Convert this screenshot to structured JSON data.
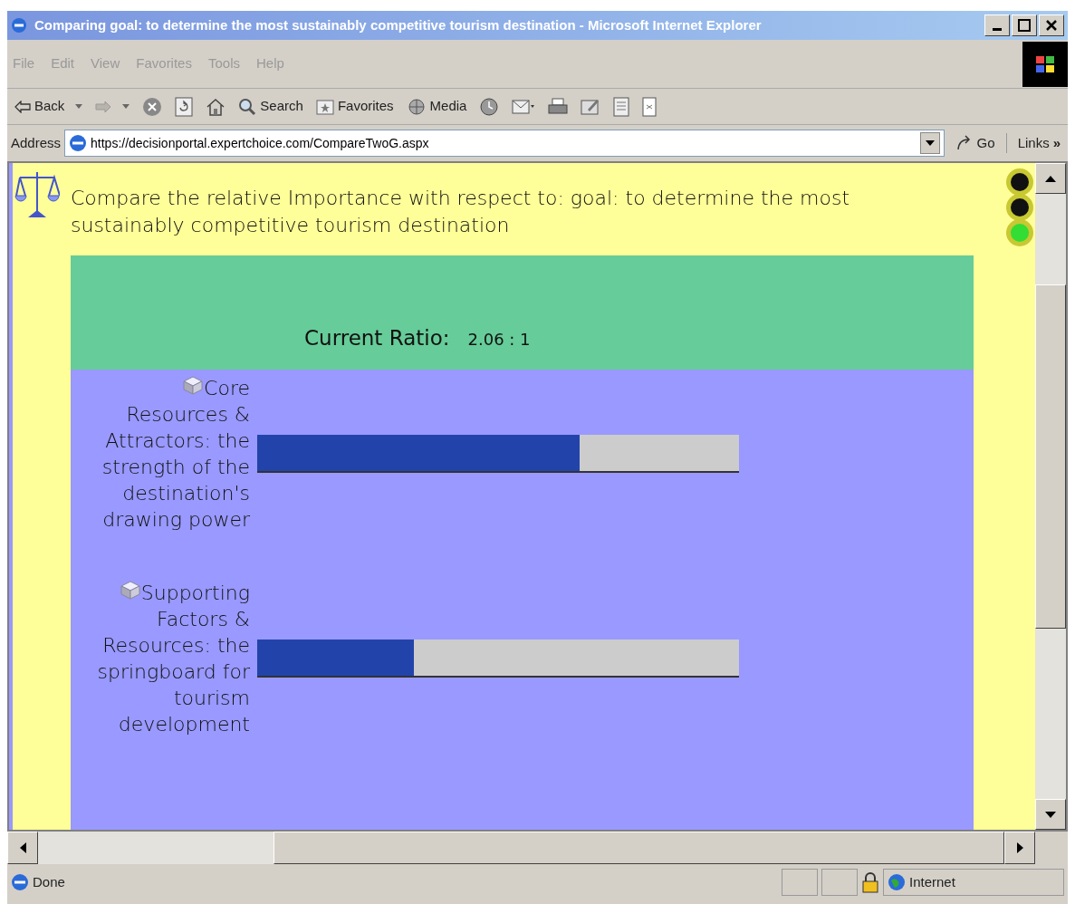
{
  "window": {
    "title": "Comparing goal: to determine the most sustainably competitive tourism destination - Microsoft Internet Explorer"
  },
  "menu": [
    "File",
    "Edit",
    "View",
    "Favorites",
    "Tools",
    "Help"
  ],
  "toolbar": [
    {
      "kind": "back",
      "label": "Back"
    },
    {
      "kind": "forward"
    },
    {
      "kind": "stop"
    },
    {
      "kind": "refresh"
    },
    {
      "kind": "home"
    },
    {
      "kind": "search",
      "label": "Search"
    },
    {
      "kind": "favorites",
      "label": "Favorites"
    },
    {
      "kind": "media",
      "label": "Media"
    },
    {
      "kind": "history"
    },
    {
      "kind": "mail"
    },
    {
      "kind": "print"
    },
    {
      "kind": "edit"
    },
    {
      "kind": "discuss"
    },
    {
      "kind": "messenger"
    }
  ],
  "address": {
    "label": "Address",
    "url": "https://decisionportal.expertchoice.com/CompareTwoG.aspx",
    "go": "Go",
    "links": "Links",
    "more": "»"
  },
  "page": {
    "heading": "Compare the relative Importance with respect to: goal: to determine the most sustainably competitive tourism destination",
    "lights": [
      {
        "on": false
      },
      {
        "on": false
      },
      {
        "on": true
      }
    ],
    "ratio_label": "Current Ratio:",
    "ratio": "2.06 : 1",
    "items": [
      {
        "name": "Core Resources & Attractors: the strength of the destination's drawing power",
        "level": 0.67
      },
      {
        "name": "Supporting Factors & Resources: the springboard for tourism development",
        "level": 0.325
      }
    ]
  },
  "status_bar": {
    "text": "Done",
    "zone": "Internet"
  }
}
